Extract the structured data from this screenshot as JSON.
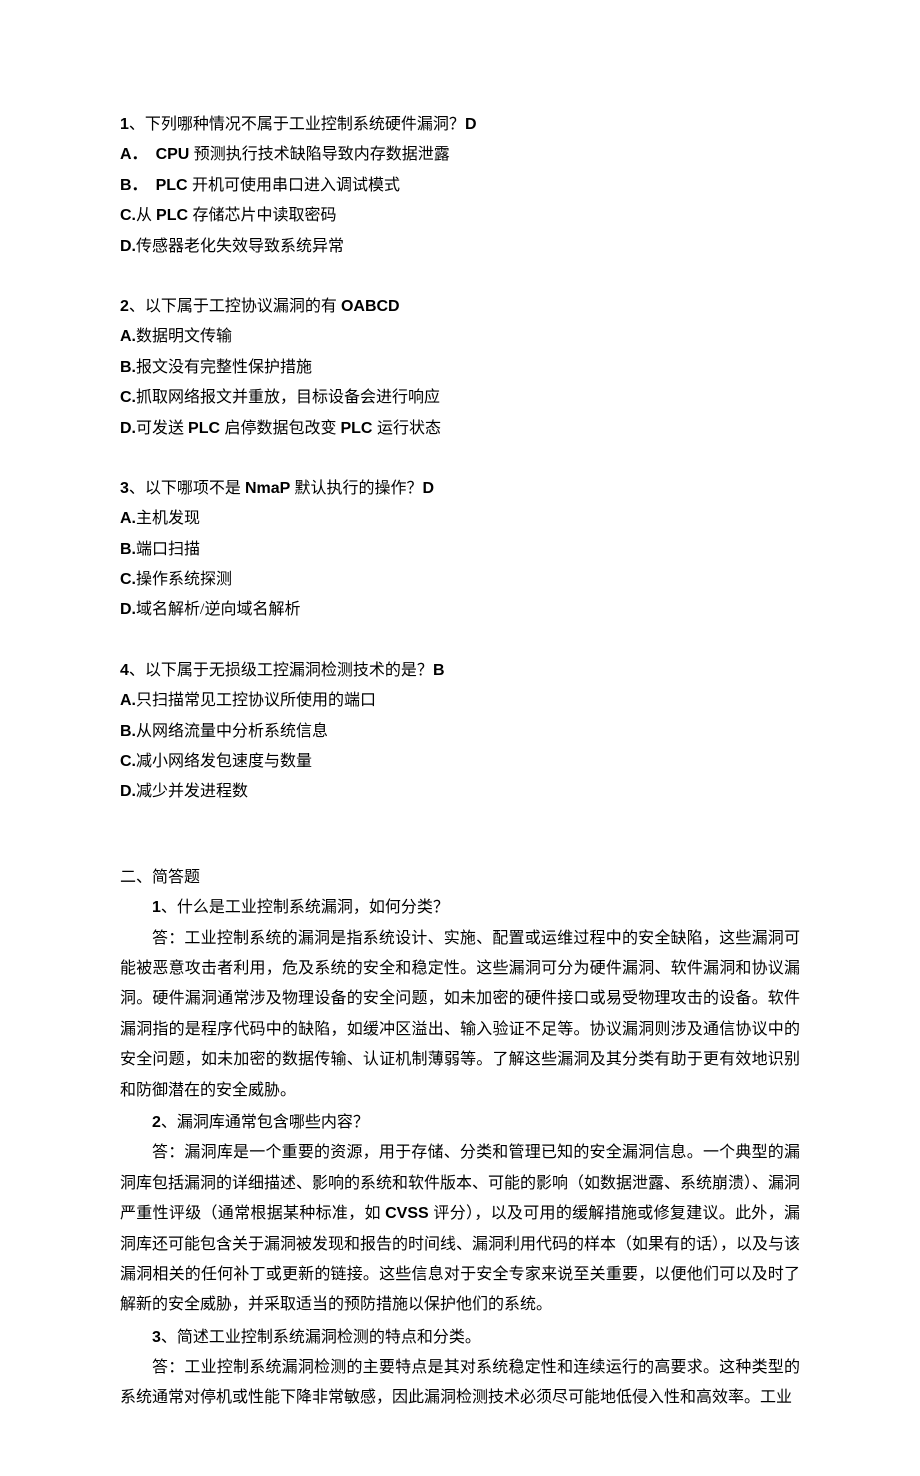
{
  "q1": {
    "num": "1",
    "sep": "、",
    "text": "下列哪种情况不属于工业控制系统硬件漏洞？",
    "ans": "D",
    "opts": [
      {
        "label": "A．",
        "pre": "CPU ",
        "text": "预测执行技术缺陷导致内存数据泄露"
      },
      {
        "label": "B．",
        "pre": "PLC ",
        "text": "开机可使用串口进入调试模式"
      },
      {
        "label": "C.",
        "mid1": "从 ",
        "bold1": "PLC ",
        "text": "存储芯片中读取密码"
      },
      {
        "label": "D.",
        "text": "传感器老化失效导致系统异常"
      }
    ]
  },
  "q2": {
    "num": "2",
    "sep": "、",
    "text": "以下属于工控协议漏洞的有 ",
    "ans": "OABCD",
    "opts": [
      {
        "label": "A.",
        "text": "数据明文传输"
      },
      {
        "label": "B.",
        "text": "报文没有完整性保护措施"
      },
      {
        "label": "C.",
        "text": "抓取网络报文并重放，目标设备会进行响应"
      },
      {
        "label": "D.",
        "mid1": "可发送 ",
        "bold1": "PLC ",
        "mid2": "启停数据包改变 ",
        "bold2": "PLC ",
        "text": "运行状态"
      }
    ]
  },
  "q3": {
    "num": "3",
    "sep": "、",
    "text_pre": "以下哪项不是 ",
    "bold_mid": "NmaP ",
    "text_post": "默认执行的操作？",
    "ans": "D",
    "opts": [
      {
        "label": "A.",
        "text": "主机发现"
      },
      {
        "label": "B.",
        "text": "端口扫描"
      },
      {
        "label": "C.",
        "text": "操作系统探测"
      },
      {
        "label": "D.",
        "text": "域名解析/逆向域名解析"
      }
    ]
  },
  "q4": {
    "num": "4",
    "sep": "、",
    "text": "以下属于无损级工控漏洞检测技术的是？",
    "ans": "B",
    "opts": [
      {
        "label": "A.",
        "text": "只扫描常见工控协议所使用的端口"
      },
      {
        "label": "B.",
        "text": "从网络流量中分析系统信息"
      },
      {
        "label": "C.",
        "text": "减小网络发包速度与数量"
      },
      {
        "label": "D.",
        "text": "减少并发进程数"
      }
    ]
  },
  "sectionTitle": "二、简答题",
  "sa1": {
    "num": "1",
    "sep": "、",
    "q": "什么是工业控制系统漏洞，如何分类？",
    "ans_label": "答：",
    "ans": "工业控制系统的漏洞是指系统设计、实施、配置或运维过程中的安全缺陷，这些漏洞可能被恶意攻击者利用，危及系统的安全和稳定性。这些漏洞可分为硬件漏洞、软件漏洞和协议漏洞。硬件漏洞通常涉及物理设备的安全问题，如未加密的硬件接口或易受物理攻击的设备。软件漏洞指的是程序代码中的缺陷，如缓冲区溢出、输入验证不足等。协议漏洞则涉及通信协议中的安全问题，如未加密的数据传输、认证机制薄弱等。了解这些漏洞及其分类有助于更有效地识别和防御潜在的安全威胁。"
  },
  "sa2": {
    "num": "2",
    "sep": "、",
    "q": "漏洞库通常包含哪些内容？",
    "ans_label": "答：",
    "ans_pre": "漏洞库是一个重要的资源，用于存储、分类和管理已知的安全漏洞信息。一个典型的漏洞库包括漏洞的详细描述、影响的系统和软件版本、可能的影响（如数据泄露、系统崩溃）、漏洞严重性评级（通常根据某种标准，如 ",
    "ans_bold": "CVSS ",
    "ans_post": "评分），以及可用的缓解措施或修复建议。此外，漏洞库还可能包含关于漏洞被发现和报告的时间线、漏洞利用代码的样本（如果有的话），以及与该漏洞相关的任何补丁或更新的链接。这些信息对于安全专家来说至关重要，以便他们可以及时了解新的安全威胁，并采取适当的预防措施以保护他们的系统。"
  },
  "sa3": {
    "num": "3",
    "sep": "、",
    "q": "简述工业控制系统漏洞检测的特点和分类。",
    "ans_label": "答：",
    "ans": "工业控制系统漏洞检测的主要特点是其对系统稳定性和连续运行的高要求。这种类型的系统通常对停机或性能下降非常敏感，因此漏洞检测技术必须尽可能地低侵入性和高效率。工业"
  }
}
